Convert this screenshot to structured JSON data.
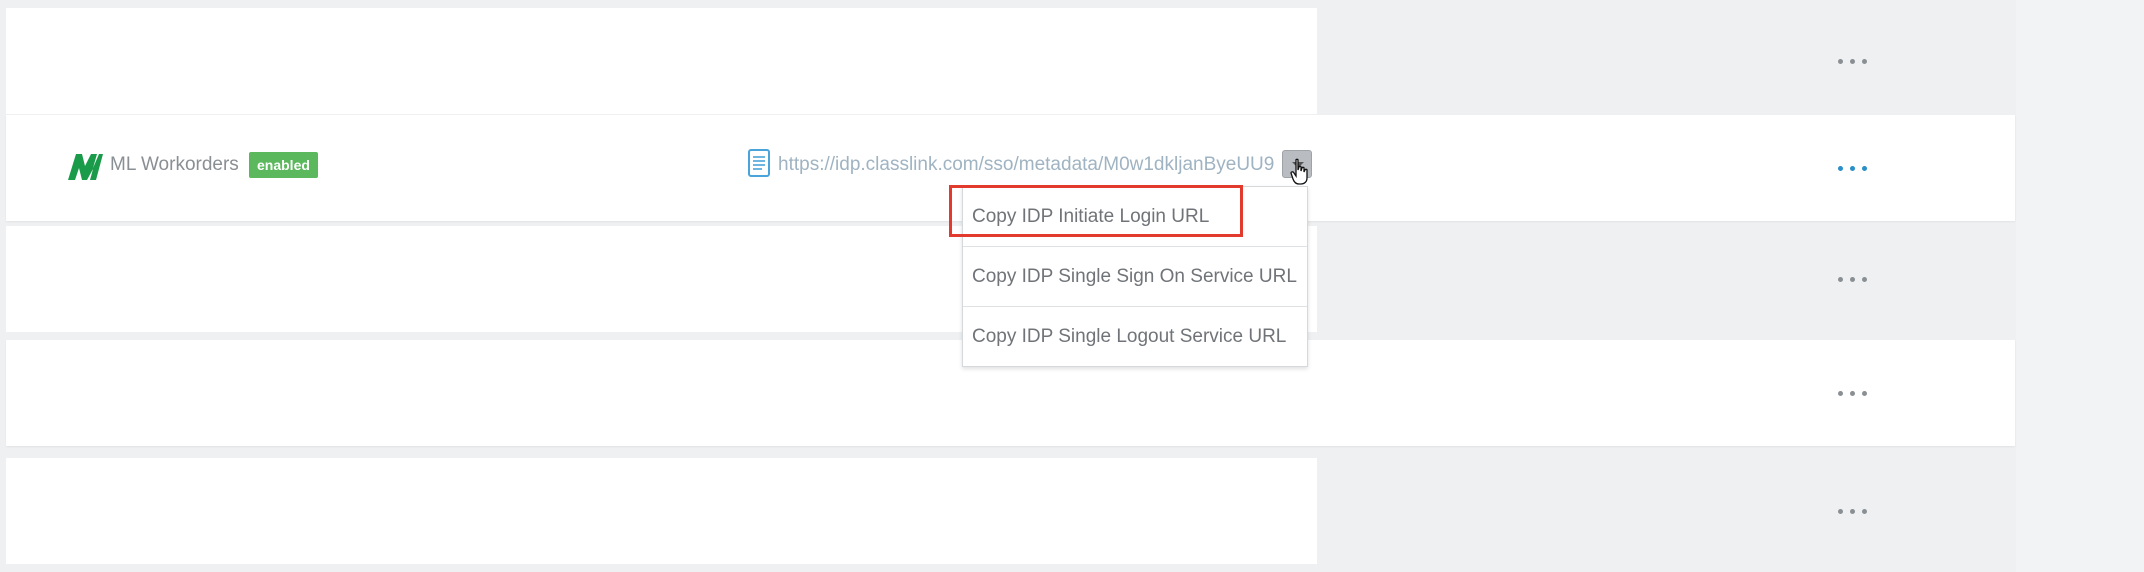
{
  "rows": [
    {
      "kind": "placeholder",
      "more_actions": "..."
    },
    {
      "kind": "app",
      "app_name": "ML Workorders",
      "status_badge": "enabled",
      "metadata_url": "https://idp.classlink.com/sso/metadata/M0w1dkljanByeUU9",
      "more_actions": "..."
    },
    {
      "kind": "placeholder",
      "more_actions": "..."
    },
    {
      "kind": "placeholder",
      "more_actions": "..."
    },
    {
      "kind": "placeholder",
      "more_actions": "..."
    }
  ],
  "dropdown": {
    "items": [
      {
        "label": "Copy IDP Initiate Login URL",
        "highlighted": true
      },
      {
        "label": "Copy IDP Single Sign On Service URL",
        "highlighted": false
      },
      {
        "label": "Copy IDP Single Logout Service URL",
        "highlighted": false
      }
    ]
  },
  "colors": {
    "badge_green": "#5cb85c",
    "logo_green": "#1a9b4a",
    "link_blue": "#2a8fc7",
    "highlight_red": "#e23b2e"
  },
  "icons": {
    "app_logo": "ml-logo-icon",
    "document": "document-icon",
    "caret": "caret-down-icon",
    "cursor": "hand-cursor-icon",
    "more": "ellipsis-icon"
  }
}
